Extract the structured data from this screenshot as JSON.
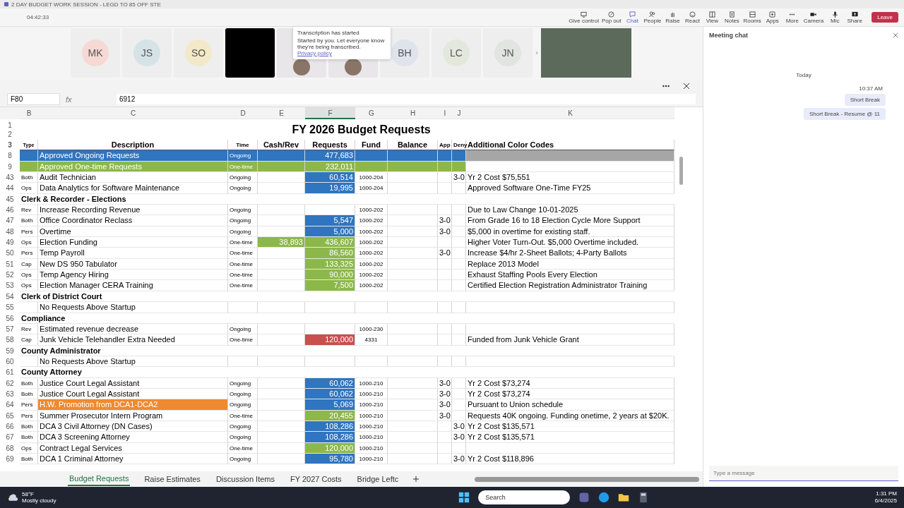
{
  "window": {
    "title": "2 DAY BUDGET WORK SESSION - LEGD TO 85 OFF STE",
    "timer": "04:42:33"
  },
  "toolbar": [
    {
      "kind": "control",
      "label": "Give control"
    },
    {
      "kind": "popout",
      "label": "Pop out"
    },
    {
      "kind": "chat",
      "label": "Chat",
      "selected": true
    },
    {
      "kind": "people",
      "label": "People",
      "selected": false
    },
    {
      "kind": "raise",
      "label": "Raise",
      "selected": false
    },
    {
      "kind": "react",
      "label": "React",
      "selected": false
    },
    {
      "kind": "view",
      "label": "View",
      "selected": false
    },
    {
      "kind": "notes",
      "label": "Notes",
      "selected": false
    },
    {
      "kind": "rooms",
      "label": "Rooms",
      "selected": false
    },
    {
      "kind": "apps",
      "label": "Apps",
      "selected": false
    },
    {
      "kind": "more",
      "label": "More",
      "selected": false
    },
    {
      "kind": "camera",
      "label": "Camera"
    },
    {
      "kind": "mic",
      "label": "Mic"
    },
    {
      "kind": "share",
      "label": "Share"
    }
  ],
  "leave_button": "Leave",
  "participants": [
    {
      "kind": "initials",
      "initials": "MK",
      "color": "#f6d9d4"
    },
    {
      "kind": "initials",
      "initials": "JS",
      "color": "#d6e3e6"
    },
    {
      "kind": "initials",
      "initials": "SO",
      "color": "#f3e8c8"
    },
    {
      "kind": "dark"
    },
    {
      "kind": "photo"
    },
    {
      "kind": "photo"
    },
    {
      "kind": "initials",
      "initials": "BH",
      "color": "#dfe3ec"
    },
    {
      "kind": "initials",
      "initials": "LC",
      "color": "#e3e8dc"
    },
    {
      "kind": "initials",
      "initials": "JN",
      "color": "#e1e5e1"
    }
  ],
  "transcription": {
    "title": "Transcription has started",
    "text": "Started by you. Let everyone know they're being transcribed.",
    "link": "Privacy policy"
  },
  "formula_bar": {
    "name_box": "F80",
    "fx": "fx",
    "formula": "6912"
  },
  "columns": [
    {
      "letter": "B",
      "selected": false
    },
    {
      "letter": "C",
      "selected": false
    },
    {
      "letter": "D",
      "selected": false
    },
    {
      "letter": "E",
      "selected": false
    },
    {
      "letter": "F",
      "selected": true
    },
    {
      "letter": "G",
      "selected": false
    },
    {
      "letter": "H",
      "selected": false
    },
    {
      "letter": "I",
      "selected": false
    },
    {
      "letter": "J",
      "selected": false
    },
    {
      "letter": "K",
      "selected": false
    }
  ],
  "sheet_title": {
    "rows": [
      "1",
      "2"
    ],
    "text": "FY 2026 Budget Requests"
  },
  "header": {
    "num": "3",
    "cells": [
      "Type",
      "Description",
      "Time",
      "Cash/Rev",
      "Requests",
      "Fund",
      "Balance",
      "App",
      "Deny",
      "Additional Color Codes"
    ]
  },
  "rows": [
    {
      "kind": "summary",
      "num": "8",
      "desc": "Approved Ongoing Requests",
      "time": "Ongoing",
      "requests": "477,683",
      "color": "#2f75c0",
      "note": {
        "color": "#a6a6a6"
      }
    },
    {
      "kind": "summary",
      "num": "9",
      "desc": "Approved One-time Requests",
      "time": "One-time",
      "requests": "232,011",
      "color": "#8cb84a"
    },
    {
      "kind": "item",
      "num": "43",
      "type": "Both",
      "desc": "Audit Technician",
      "time": "Ongoing",
      "requests": "60,514",
      "color": "#2f75c0",
      "fund": "1000-204",
      "deny": "3-0",
      "note": "Yr 2 Cost $75,551"
    },
    {
      "kind": "item",
      "num": "44",
      "type": "Ops",
      "desc": "Data Analytics for Software Maintenance",
      "time": "Ongoing",
      "requests": "19,995",
      "color": "#2f75c0",
      "fund": "1000-204",
      "note": "Approved Software One-Time FY25"
    },
    {
      "kind": "section",
      "num": "45",
      "desc": "Clerk & Recorder - Elections"
    },
    {
      "kind": "item",
      "num": "46",
      "type": "Rev",
      "desc": "Increase Recording Revenue",
      "time": "Ongoing",
      "fund": "1000-202",
      "note": "Due to Law Change 10-01-2025"
    },
    {
      "kind": "item",
      "num": "47",
      "type": "Both",
      "desc": "Office Coordinator Reclass",
      "time": "Ongoing",
      "requests": "5,547",
      "color": "#2f75c0",
      "fund": "1000-202",
      "app": "3-0",
      "note": "From Grade 16 to 18 Election Cycle More Support"
    },
    {
      "kind": "item",
      "num": "48",
      "type": "Pers",
      "desc": "Overtime",
      "time": "Ongoing",
      "requests": "5,000",
      "color": "#2f75c0",
      "fund": "1000-202",
      "app": "3-0",
      "note": "$5,000 in overtime for existing staff."
    },
    {
      "kind": "item",
      "num": "49",
      "type": "Ops",
      "desc": "Election Funding",
      "time": "One-time",
      "cash": {
        "text": "38,893",
        "color": "#8cb84a"
      },
      "requests": "436,607",
      "color": "#8cb84a",
      "fund": "1000-202",
      "note": "Higher Voter Turn-Out. $5,000 Overtime included."
    },
    {
      "kind": "item",
      "num": "50",
      "type": "Pers",
      "desc": "Temp Payroll",
      "time": "One-time",
      "requests": "86,560",
      "color": "#8cb84a",
      "fund": "1000-202",
      "app": "3-0",
      "note": "Increase $4/hr 2-Sheet Ballots; 4-Party Ballots"
    },
    {
      "kind": "item",
      "num": "51",
      "type": "Cap",
      "desc": "New DS 950 Tabulator",
      "time": "One-time",
      "requests": "133,325",
      "color": "#8cb84a",
      "fund": "1000-202",
      "note": "Replace 2013 Model"
    },
    {
      "kind": "item",
      "num": "52",
      "type": "Ops",
      "desc": "Temp Agency Hiring",
      "time": "One-time",
      "requests": "90,000",
      "color": "#8cb84a",
      "fund": "1000-202",
      "note": "Exhaust Staffing Pools Every Election"
    },
    {
      "kind": "item",
      "num": "53",
      "type": "Ops",
      "desc": "Election Manager CERA Training",
      "time": "One-time",
      "requests": "7,500",
      "color": "#8cb84a",
      "fund": "1000-202",
      "note": "Certified Election Registration Administrator Training"
    },
    {
      "kind": "section",
      "num": "54",
      "desc": "Clerk of District Court"
    },
    {
      "kind": "item",
      "num": "55",
      "desc": "No Requests Above Startup"
    },
    {
      "kind": "section",
      "num": "56",
      "desc": "Compliance"
    },
    {
      "kind": "item",
      "num": "57",
      "type": "Rev",
      "desc": "Estimated revenue decrease",
      "time": "Ongoing",
      "fund": "1000-230"
    },
    {
      "kind": "item",
      "num": "58",
      "type": "Cap",
      "desc": "Junk Vehicle Telehandler Extra Needed",
      "time": "One-time",
      "requests": "120,000",
      "color": "#c8504e",
      "fund": "4331",
      "note": "Funded from Junk Vehicle Grant"
    },
    {
      "kind": "section",
      "num": "59",
      "desc": "County Administrator"
    },
    {
      "kind": "item",
      "num": "60",
      "desc": "No Requests Above Startup"
    },
    {
      "kind": "section",
      "num": "61",
      "desc": "County Attorney"
    },
    {
      "kind": "item",
      "num": "62",
      "type": "Both",
      "desc": "Justice Court Legal Assistant",
      "time": "Ongoing",
      "requests": "60,062",
      "color": "#2f75c0",
      "fund": "1000-210",
      "app": "3-0",
      "note": "Yr 2 Cost $73,274"
    },
    {
      "kind": "item",
      "num": "63",
      "type": "Both",
      "desc": "Justice Court Legal Assistant",
      "time": "Ongoing",
      "requests": "60,062",
      "color": "#2f75c0",
      "fund": "1000-210",
      "app": "3-0",
      "note": "Yr 2 Cost $73,274"
    },
    {
      "kind": "item",
      "num": "64",
      "type": "Pers",
      "desc": {
        "text": "H.W. Promotion from DCA1-DCA2",
        "color": "#f08a30"
      },
      "time": "Ongoing",
      "requests": "5,069",
      "color": "#2f75c0",
      "fund": "1000-210",
      "app": "3-0",
      "note": "Pursuant to Union schedule"
    },
    {
      "kind": "item",
      "num": "65",
      "type": "Pers",
      "desc": "Summer Prosecutor Intern Program",
      "time": "One-time",
      "requests": "20,455",
      "color": "#8cb84a",
      "fund": "1000-210",
      "app": "3-0",
      "note": "Requests 40K ongoing. Funding onetime, 2 years at $20K."
    },
    {
      "kind": "item",
      "num": "66",
      "type": "Both",
      "desc": "DCA 3 Civil Attorney (DN Cases)",
      "time": "Ongoing",
      "requests": "108,286",
      "color": "#2f75c0",
      "fund": "1000-210",
      "deny": "3-0",
      "note": "Yr 2 Cost $135,571"
    },
    {
      "kind": "item",
      "num": "67",
      "type": "Both",
      "desc": "DCA 3 Screening Attorney",
      "time": "Ongoing",
      "requests": "108,286",
      "color": "#2f75c0",
      "fund": "1000-210",
      "deny": "3-0",
      "note": "Yr 2 Cost $135,571"
    },
    {
      "kind": "item",
      "num": "68",
      "type": "Ops",
      "desc": "Contract Legal Services",
      "time": "One-time",
      "requests": "120,000",
      "color": "#8cb84a",
      "fund": "1000-210"
    },
    {
      "kind": "item",
      "num": "69",
      "type": "Both",
      "desc": "DCA 1 Criminal Attorney",
      "time": "Ongoing",
      "requests": "95,780",
      "color": "#2f75c0",
      "fund": "1000-210",
      "deny": "3-0",
      "note": "Yr 2 Cost $118,896"
    }
  ],
  "sheet_tabs": [
    {
      "label": "Budget Requests",
      "selected": true
    },
    {
      "label": "Raise Estimates",
      "selected": false
    },
    {
      "label": "Discussion Items",
      "selected": false
    },
    {
      "label": "FY 2027 Costs",
      "selected": false
    },
    {
      "label": "Bridge Leftc",
      "selected": false
    }
  ],
  "chat": {
    "title": "Meeting chat",
    "day": "Today",
    "time": "10:37 AM",
    "messages": [
      "Short Break",
      "Short Break - Resume @ 11"
    ],
    "placeholder": "Type a message"
  },
  "taskbar": {
    "temp": "58°F",
    "weather": "Mostly cloudy",
    "search": "Search",
    "time": "1:31 PM",
    "date": "6/4/2025"
  }
}
